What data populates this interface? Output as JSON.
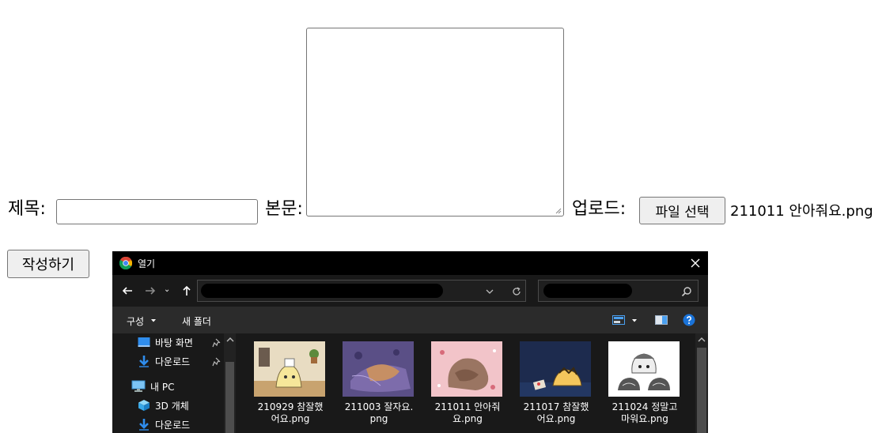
{
  "form": {
    "title_label": "제목:",
    "body_label": "본문:",
    "upload_label": "업로드:",
    "file_button": "파일 선택",
    "file_name": "211011 안아줘요.png",
    "submit_button": "작성하기",
    "title_value": "",
    "body_value": ""
  },
  "dialog": {
    "title": "열기",
    "toolbar": {
      "organize": "구성",
      "new_folder": "새 폴더"
    },
    "sidebar": [
      {
        "label": "바탕 화면",
        "icon": "desktop-icon",
        "pinned": true
      },
      {
        "label": "다운로드",
        "icon": "download-icon",
        "pinned": true
      },
      {
        "label": "내 PC",
        "icon": "pc-icon",
        "pinned": false
      },
      {
        "label": "3D 개체",
        "icon": "3d-objects-icon",
        "pinned": false
      },
      {
        "label": "다운로드",
        "icon": "download-icon",
        "pinned": false
      }
    ],
    "files": [
      {
        "line1": "210929 참잘했",
        "line2": "어요.png"
      },
      {
        "line1": "211003 잘자요.",
        "line2": "png"
      },
      {
        "line1": "211011 안아줘",
        "line2": "요.png"
      },
      {
        "line1": "211017 참잘했",
        "line2": "어요.png"
      },
      {
        "line1": "211024 정말고",
        "line2": "마워요.png"
      }
    ]
  },
  "colors": {
    "dialog_bg": "#191919",
    "titlebar_bg": "#000000",
    "cmdbar_bg": "#2b2b2b",
    "folder_blue": "#2f8ded"
  }
}
